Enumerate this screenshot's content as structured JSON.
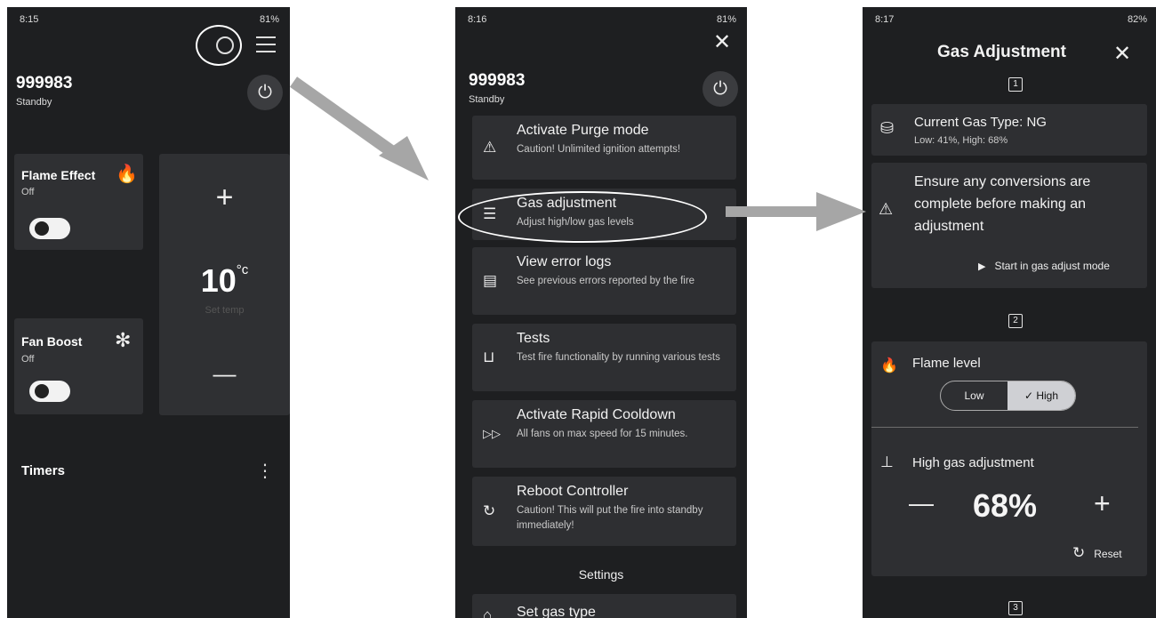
{
  "screen1": {
    "status": {
      "time": "8:15",
      "right": "81%"
    },
    "device_id": "999983",
    "device_state": "Standby",
    "flame": {
      "label": "Flame Effect",
      "state": "Off"
    },
    "fan": {
      "label": "Fan Boost",
      "state": "Off"
    },
    "temp": {
      "plus": "+",
      "value": "10",
      "unit": "°c",
      "caption": "Set temp",
      "minus": "—"
    },
    "timers": "Timers",
    "kebab": "⋮"
  },
  "screen2": {
    "status": {
      "time": "8:16",
      "right": "81%"
    },
    "close": "✕",
    "device_id": "999983",
    "device_state": "Standby",
    "items": [
      {
        "title": "Activate Purge mode",
        "subtitle": "Caution! Unlimited ignition attempts!",
        "icon": "warning-icon"
      },
      {
        "title": "Gas adjustment",
        "subtitle": "Adjust high/low gas levels",
        "icon": "list-icon"
      },
      {
        "title": "View error logs",
        "subtitle": "See previous errors reported by the fire",
        "icon": "document-icon"
      },
      {
        "title": "Tests",
        "subtitle": "Test fire functionality by running various tests",
        "icon": "test-tube-icon"
      },
      {
        "title": "Activate Rapid Cooldown",
        "subtitle": "All fans on max speed for 15 minutes.",
        "icon": "fast-forward-icon"
      },
      {
        "title": "Reboot Controller",
        "subtitle": "Caution! This will put the fire into standby immediately!",
        "icon": "refresh-icon"
      }
    ],
    "settings_heading": "Settings",
    "last_item": "Set gas type"
  },
  "screen3": {
    "status": {
      "time": "8:17",
      "right": "82%"
    },
    "title": "Gas Adjustment",
    "close": "✕",
    "step1": "1",
    "gas_type": "Current Gas Type: NG",
    "gas_levels": "Low: 41%, High: 68%",
    "warning": "Ensure any conversions are complete before making an adjustment",
    "start_button": "Start in gas adjust mode",
    "step2": "2",
    "flame_level": "Flame level",
    "seg_low": "Low",
    "seg_high": "✓ High",
    "high_gas_label": "High gas adjustment",
    "minus": "—",
    "value": "68%",
    "plus": "+",
    "reset": "Reset",
    "step3": "3"
  },
  "colors": {
    "phone_bg": "#1e1f21",
    "card_bg": "#2f3033",
    "arrow": "#a8a8a8"
  }
}
